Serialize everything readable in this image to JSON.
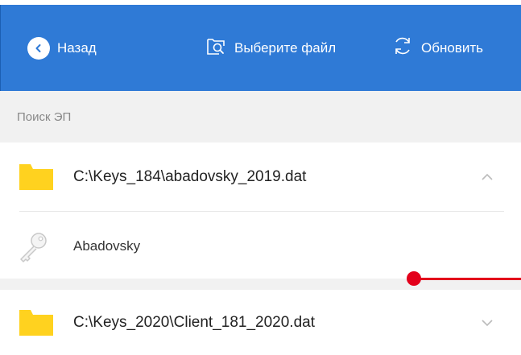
{
  "toolbar": {
    "back_label": "Назад",
    "choose_file_label": "Выберите файл",
    "refresh_label": "Обновить"
  },
  "section": {
    "title": "Поиск ЭП"
  },
  "containers": [
    {
      "path": "C:\\Keys_184\\abadovsky_2019.dat",
      "expanded": true,
      "chevron": "chevron-up-icon",
      "keys": [
        {
          "name": "Abadovsky",
          "icon": "key-icon"
        }
      ]
    },
    {
      "path": "C:\\Keys_2020\\Client_181_2020.dat",
      "expanded": false,
      "chevron": "chevron-down-icon"
    }
  ],
  "colors": {
    "toolbar_bg": "#2f7ad6",
    "folder": "#ffd21f",
    "pointer": "#e3001b",
    "section_bg": "#f1f1f1"
  }
}
